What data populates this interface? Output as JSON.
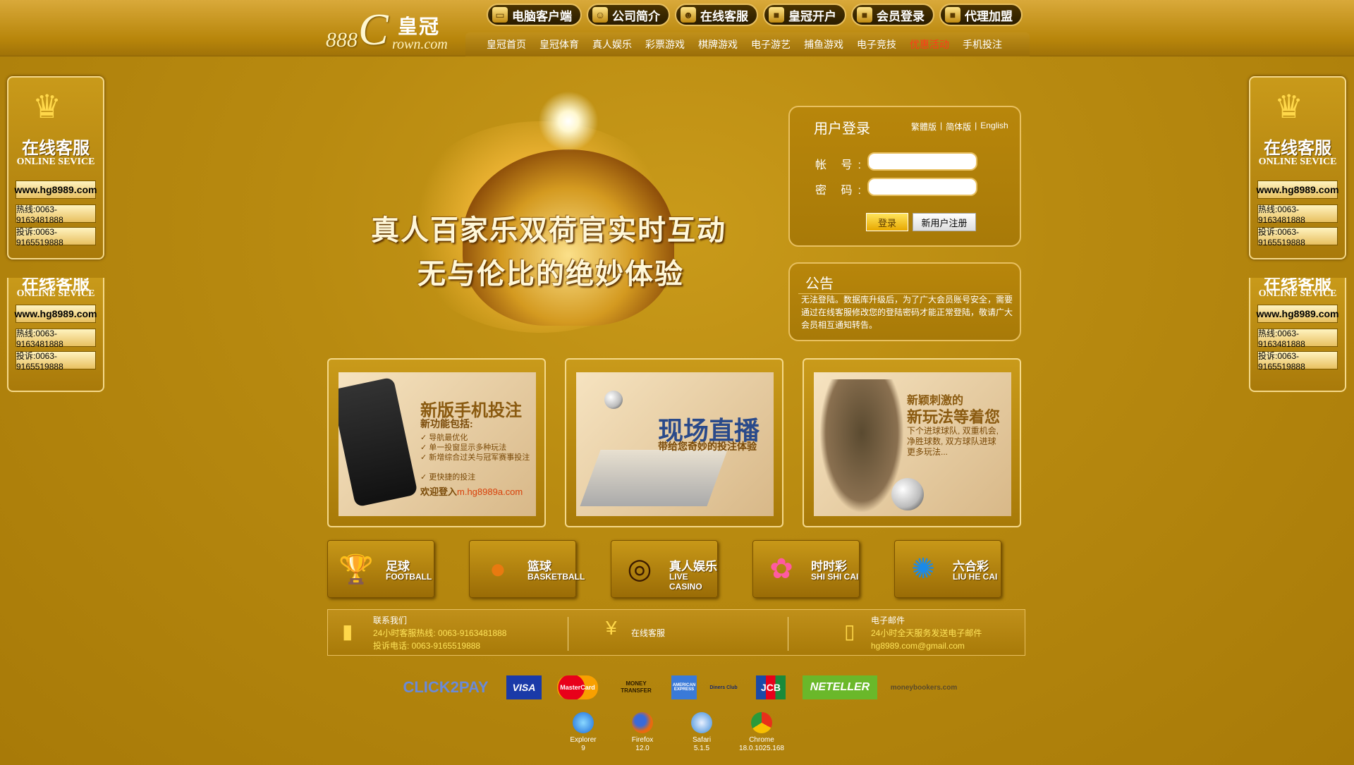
{
  "header": {
    "logo": {
      "num": "888",
      "letter": "C",
      "cn": "皇冠",
      "en": "rown.com"
    },
    "top_buttons": [
      {
        "label": "电脑客户端",
        "icon": "monitor-icon"
      },
      {
        "label": "公司简介",
        "icon": "person-icon"
      },
      {
        "label": "在线客服",
        "icon": "agent-icon"
      },
      {
        "label": "皇冠开户",
        "icon": "lock-icon"
      },
      {
        "label": "会员登录",
        "icon": "lock-icon"
      },
      {
        "label": "代理加盟",
        "icon": "lock-icon"
      }
    ],
    "nav": [
      "皇冠首页",
      "皇冠体育",
      "真人娱乐",
      "彩票游戏",
      "棋牌游戏",
      "电子游艺",
      "捕鱼游戏",
      "电子竞技",
      "优惠活动",
      "手机投注"
    ]
  },
  "side_widget": {
    "title_cn": "在线客服",
    "title_en": "ONLINE SEVICE",
    "url": "www.hg8989.com",
    "hotline": "热线:0063-9163481888",
    "complaint": "投诉:0063-9165519888"
  },
  "banner": {
    "line1": "真人百家乐双荷官实时互动",
    "line2": "无与伦比的绝妙体验"
  },
  "login": {
    "title": "用户登录",
    "langs": [
      "繁體版",
      "|",
      "简体版",
      "|",
      "English"
    ],
    "account_label": "帐 号:",
    "password_label": "密 码:",
    "account_value": "",
    "password_value": "",
    "login_btn": "登录",
    "register_btn": "新用户注册"
  },
  "notice": {
    "title": "公告",
    "body": "无法登陆。数据库升级后，为了广大会员账号安全，需要通过在线客服修改您的登陆密码才能正常登陆，敬请广大会员相互通知转告。"
  },
  "cards": [
    {
      "head": "新版手机投注",
      "sub1": "新功能包括:",
      "items": [
        "导航最优化",
        "单一投窗显示多种玩法",
        "新增综合过关与冠军赛事投注",
        "更快捷的投注"
      ],
      "welcome": "欢迎登入",
      "link": "m.hg8989a.com"
    },
    {
      "head": "现场直播",
      "sub1": "带给您奇妙的投注体验"
    },
    {
      "head_small": "新颖刺激的",
      "head": "新玩法等着您",
      "sub1": "下个进球球队, 双重机会,",
      "sub2": "净胜球数, 双方球队进球",
      "sub3": "更多玩法..."
    }
  ],
  "games": [
    {
      "cn": "足球",
      "en": "FOOTBALL",
      "icon": "trophy-icon"
    },
    {
      "cn": "篮球",
      "en": "BASKETBALL",
      "icon": "basketball-icon"
    },
    {
      "cn": "真人娱乐",
      "en": "LIVE CASINO",
      "icon": "roulette-icon"
    },
    {
      "cn": "时时彩",
      "en": "SHI SHI CAI",
      "icon": "lottery-balls-icon"
    },
    {
      "cn": "六合彩",
      "en": "LIU HE CAI",
      "icon": "lottery-logo-icon"
    }
  ],
  "contact": {
    "c1_title": "联系我们",
    "c1_line1": "24小时客服热线: 0063-9163481888",
    "c1_line2": "投诉电话: 0063-9165519888",
    "c2_title": "在线客服",
    "c3_title": "电子邮件",
    "c3_line1": "24小时全天服务发送电子邮件",
    "c3_line2": "hg8989.com@gmail.com"
  },
  "payments": [
    "CLICK2PAY",
    "VISA",
    "MasterCard",
    "MONEY TRANSFER",
    "AMERICAN EXPRESS",
    "Diners Club",
    "JCB",
    "NETELLER",
    "moneybookers.com"
  ],
  "browsers": [
    {
      "name": "Explorer",
      "ver": "9"
    },
    {
      "name": "Firefox",
      "ver": "12.0"
    },
    {
      "name": "Safari",
      "ver": "5.1.5"
    },
    {
      "name": "Chrome",
      "ver": "18.0.1025.168"
    }
  ],
  "colors": {
    "background": "#b8860b",
    "accent": "#e8c060",
    "hot_link": "#ff3a1a"
  }
}
